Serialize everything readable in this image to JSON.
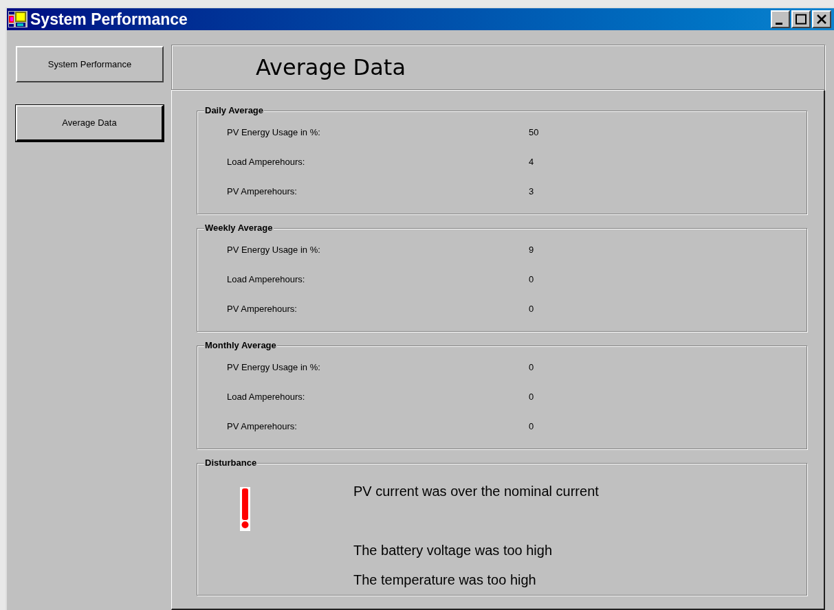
{
  "window": {
    "title": "System Performance"
  },
  "nav": [
    {
      "label": "System Performance",
      "selected": false
    },
    {
      "label": "Average Data",
      "selected": true
    }
  ],
  "header": "Average Data",
  "groups": [
    {
      "title": "Daily Average",
      "rows": [
        {
          "label": "PV Energy Usage in %:",
          "value": "50"
        },
        {
          "label": "Load Amperehours:",
          "value": "4"
        },
        {
          "label": "PV Amperehours:",
          "value": "3"
        }
      ]
    },
    {
      "title": "Weekly Average",
      "rows": [
        {
          "label": "PV Energy Usage in %:",
          "value": "9"
        },
        {
          "label": "Load Amperehours:",
          "value": "0"
        },
        {
          "label": "PV Amperehours:",
          "value": "0"
        }
      ]
    },
    {
      "title": "Monthly Average",
      "rows": [
        {
          "label": "PV Energy Usage in %:",
          "value": "0"
        },
        {
          "label": "Load Amperehours:",
          "value": "0"
        },
        {
          "label": "PV Amperehours:",
          "value": "0"
        }
      ]
    }
  ],
  "disturbance": {
    "title": "Disturbance",
    "messages": [
      "PV current was over the nominal current",
      "The battery voltage was too high",
      "The temperature was too high"
    ]
  }
}
